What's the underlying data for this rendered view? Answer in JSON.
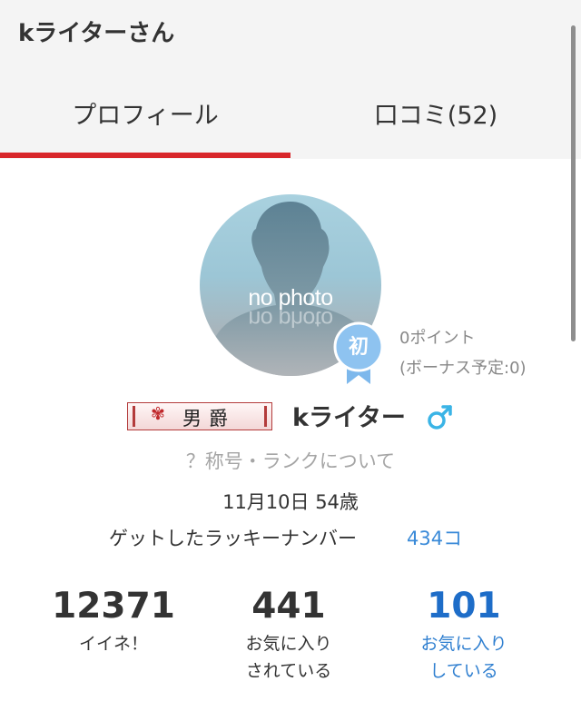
{
  "header": {
    "title": "kライターさん"
  },
  "tabs": [
    {
      "label": "プロフィール",
      "active": true
    },
    {
      "label": "口コミ(52)",
      "active": false
    }
  ],
  "profile": {
    "avatar_text": "no photo",
    "first_badge": "初",
    "points": "0ポイント",
    "bonus": "(ボーナス予定:0)",
    "rank_badge": "男爵",
    "username": "kライター",
    "gender_icon": "male-icon",
    "rank_link": "？称号・ランクについて",
    "birthday": "11月10日 54歳",
    "lucky_label": "ゲットしたラッキーナンバー",
    "lucky_value": "434コ"
  },
  "stats": [
    {
      "value": "12371",
      "label_line1": "イイネ！",
      "label_line2": ""
    },
    {
      "value": "441",
      "label_line1": "お気に入り",
      "label_line2": "されている"
    },
    {
      "value": "101",
      "label_line1": "お気に入り",
      "label_line2": "している"
    }
  ],
  "colors": {
    "accent_red": "#d8262a",
    "link_blue": "#3a8ad8",
    "male_blue": "#3ab4e6",
    "badge_blue": "#7db8ec"
  }
}
